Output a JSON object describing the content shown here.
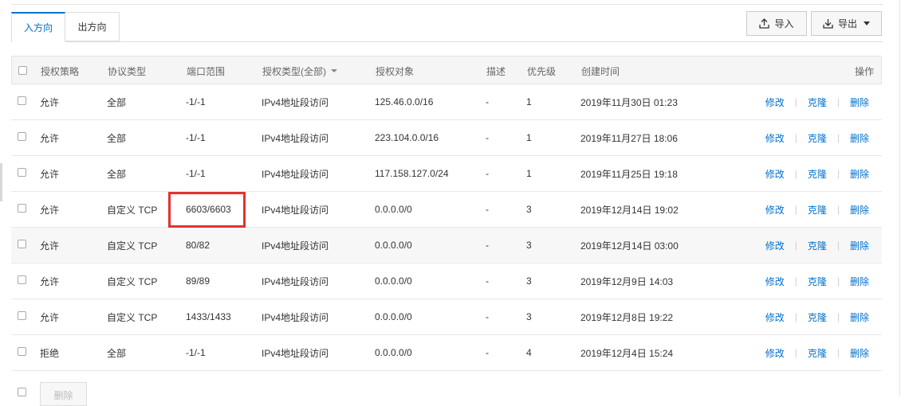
{
  "tabs": [
    {
      "label": "入方向",
      "active": true
    },
    {
      "label": "出方向",
      "active": false
    }
  ],
  "toolbar": {
    "import_label": "导入",
    "export_label": "导出"
  },
  "table": {
    "headers": {
      "policy": "授权策略",
      "protocol": "协议类型",
      "port": "端口范围",
      "auth_type": "授权类型(全部)",
      "target": "授权对象",
      "description": "描述",
      "priority": "优先级",
      "created": "创建时间",
      "actions": "操作"
    },
    "rows": [
      {
        "policy": "允许",
        "protocol": "全部",
        "port": "-1/-1",
        "auth_type": "IPv4地址段访问",
        "target": "125.46.0.0/16",
        "description": "-",
        "priority": "1",
        "created": "2019年11月30日 01:23",
        "highlight": false
      },
      {
        "policy": "允许",
        "protocol": "全部",
        "port": "-1/-1",
        "auth_type": "IPv4地址段访问",
        "target": "223.104.0.0/16",
        "description": "-",
        "priority": "1",
        "created": "2019年11月27日 18:06",
        "highlight": false
      },
      {
        "policy": "允许",
        "protocol": "全部",
        "port": "-1/-1",
        "auth_type": "IPv4地址段访问",
        "target": "117.158.127.0/24",
        "description": "-",
        "priority": "1",
        "created": "2019年11月25日 19:18",
        "highlight": false
      },
      {
        "policy": "允许",
        "protocol": "自定义 TCP",
        "port": "6603/6603",
        "auth_type": "IPv4地址段访问",
        "target": "0.0.0.0/0",
        "description": "-",
        "priority": "3",
        "created": "2019年12月14日 19:02",
        "highlight": true
      },
      {
        "policy": "允许",
        "protocol": "自定义 TCP",
        "port": "80/82",
        "auth_type": "IPv4地址段访问",
        "target": "0.0.0.0/0",
        "description": "-",
        "priority": "3",
        "created": "2019年12月14日 03:00",
        "highlight": false
      },
      {
        "policy": "允许",
        "protocol": "自定义 TCP",
        "port": "89/89",
        "auth_type": "IPv4地址段访问",
        "target": "0.0.0.0/0",
        "description": "-",
        "priority": "3",
        "created": "2019年12月9日 14:03",
        "highlight": false
      },
      {
        "policy": "允许",
        "protocol": "自定义 TCP",
        "port": "1433/1433",
        "auth_type": "IPv4地址段访问",
        "target": "0.0.0.0/0",
        "description": "-",
        "priority": "3",
        "created": "2019年12月8日 19:22",
        "highlight": false
      },
      {
        "policy": "拒绝",
        "protocol": "全部",
        "port": "-1/-1",
        "auth_type": "IPv4地址段访问",
        "target": "0.0.0.0/0",
        "description": "-",
        "priority": "4",
        "created": "2019年12月4日 15:24",
        "highlight": false
      }
    ],
    "actions": {
      "edit": "修改",
      "clone": "克隆",
      "delete": "删除"
    },
    "row_hover_index": 4
  },
  "footer": {
    "delete_button": "删除"
  },
  "colors": {
    "link": "#0070cc",
    "highlight_border": "#e8312d",
    "header_bg": "#f5f5f6"
  },
  "icons": {
    "import": "upload-icon",
    "export": "download-icon"
  }
}
